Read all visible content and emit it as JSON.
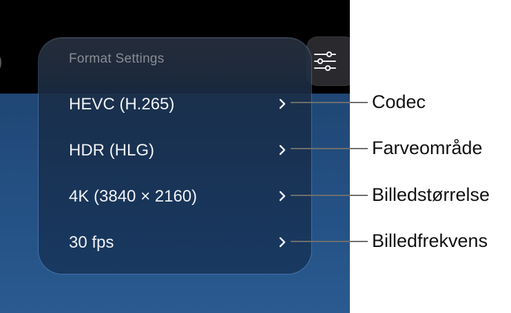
{
  "panel": {
    "title": "Format Settings",
    "rows": [
      {
        "label": "HEVC (H.265)"
      },
      {
        "label": "HDR (HLG)"
      },
      {
        "label": "4K (3840 × 2160)"
      },
      {
        "label": "30 fps"
      }
    ]
  },
  "callouts": [
    {
      "label": "Codec"
    },
    {
      "label": "Farveområde"
    },
    {
      "label": "Billedstørrelse"
    },
    {
      "label": "Billedfrekvens"
    }
  ],
  "icons": {
    "settings": "sliders-icon",
    "row_disclosure": "chevron-right-icon"
  },
  "colors": {
    "callout_line": "#6e6e6e",
    "panel_text": "#f1f3f6",
    "panel_title": "#8a8d93"
  }
}
